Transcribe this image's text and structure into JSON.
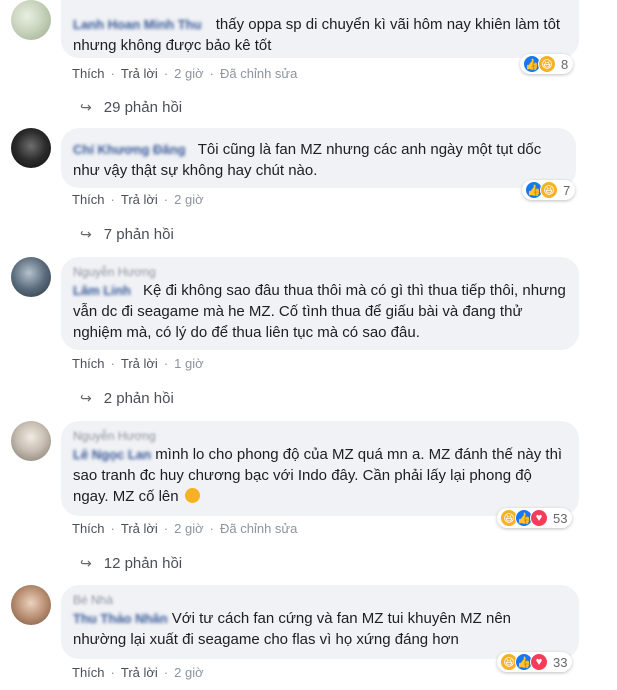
{
  "comments": [
    {
      "name": "Lanh Hoan Minh Thu",
      "sub": "",
      "text": "thấy oppa sp di chuyển kì vãi hôm nay khiên làm tôt nhưng không được bảo kê tốt",
      "like": "Thích",
      "reply": "Trả lời",
      "time": "2 giờ",
      "edited": "Đã chỉnh sửa",
      "reactions": [
        "like",
        "haha"
      ],
      "reaction_count": "8",
      "replies": "29 phản hồi"
    },
    {
      "name": "Chí Khương Đăng",
      "sub": "",
      "text": "Tôi cũng là fan MZ nhưng các anh ngày một tụt dốc như vậy thật sự không hay chút nào.",
      "like": "Thích",
      "reply": "Trả lời",
      "time": "2 giờ",
      "edited": "",
      "reactions": [
        "like",
        "haha"
      ],
      "reaction_count": "7",
      "replies": "7 phản hồi"
    },
    {
      "name": "Lâm Linh",
      "sub": "Nguyễn Hương",
      "text": "Kệ đi không sao đâu thua thôi mà có gì thì thua tiếp thôi, nhưng vẫn dc đi seagame mà he MZ. Cố tình thua để giấu bài và đang thử nghiệm mà, có lý do để thua liên tục mà có sao đâu.",
      "like": "Thích",
      "reply": "Trả lời",
      "time": "1 giờ",
      "edited": "",
      "reactions": [],
      "reaction_count": "",
      "replies": "2 phản hồi"
    },
    {
      "name": "Lê Ngọc Lan",
      "sub": "Nguyễn Hương",
      "text": "mình lo cho phong độ của MZ quá mn a. MZ đánh thế này thì sao tranh đc huy chương bạc với Indo đây. Cần phải lấy lại phong độ ngay. MZ cố lên",
      "like": "Thích",
      "reply": "Trả lời",
      "time": "2 giờ",
      "edited": "Đã chỉnh sửa",
      "reactions": [
        "haha",
        "like",
        "love"
      ],
      "reaction_count": "53",
      "replies": "12 phản hồi"
    },
    {
      "name": "Thu Thảo Nhân",
      "sub": "Bé Nhà",
      "text": "Với tư cách fan cứng và fan MZ tui khuyên MZ nên nhường lại xuất đi seagame cho flas vì họ xứng đáng hơn",
      "like": "Thích",
      "reply": "Trả lời",
      "time": "2 giờ",
      "edited": "",
      "reactions": [
        "haha",
        "like",
        "love"
      ],
      "reaction_count": "33",
      "replies": ""
    }
  ],
  "icons": {
    "reply_arrow": "reply-arrow-icon",
    "like": "like-reaction-icon",
    "haha": "haha-reaction-icon",
    "love": "love-reaction-icon"
  },
  "colors": {
    "bubble": "#f0f2f5",
    "name": "#385898",
    "meta": "#4b4f56",
    "like": "#1877f2",
    "haha": "#f7b125",
    "love": "#f33e58"
  }
}
